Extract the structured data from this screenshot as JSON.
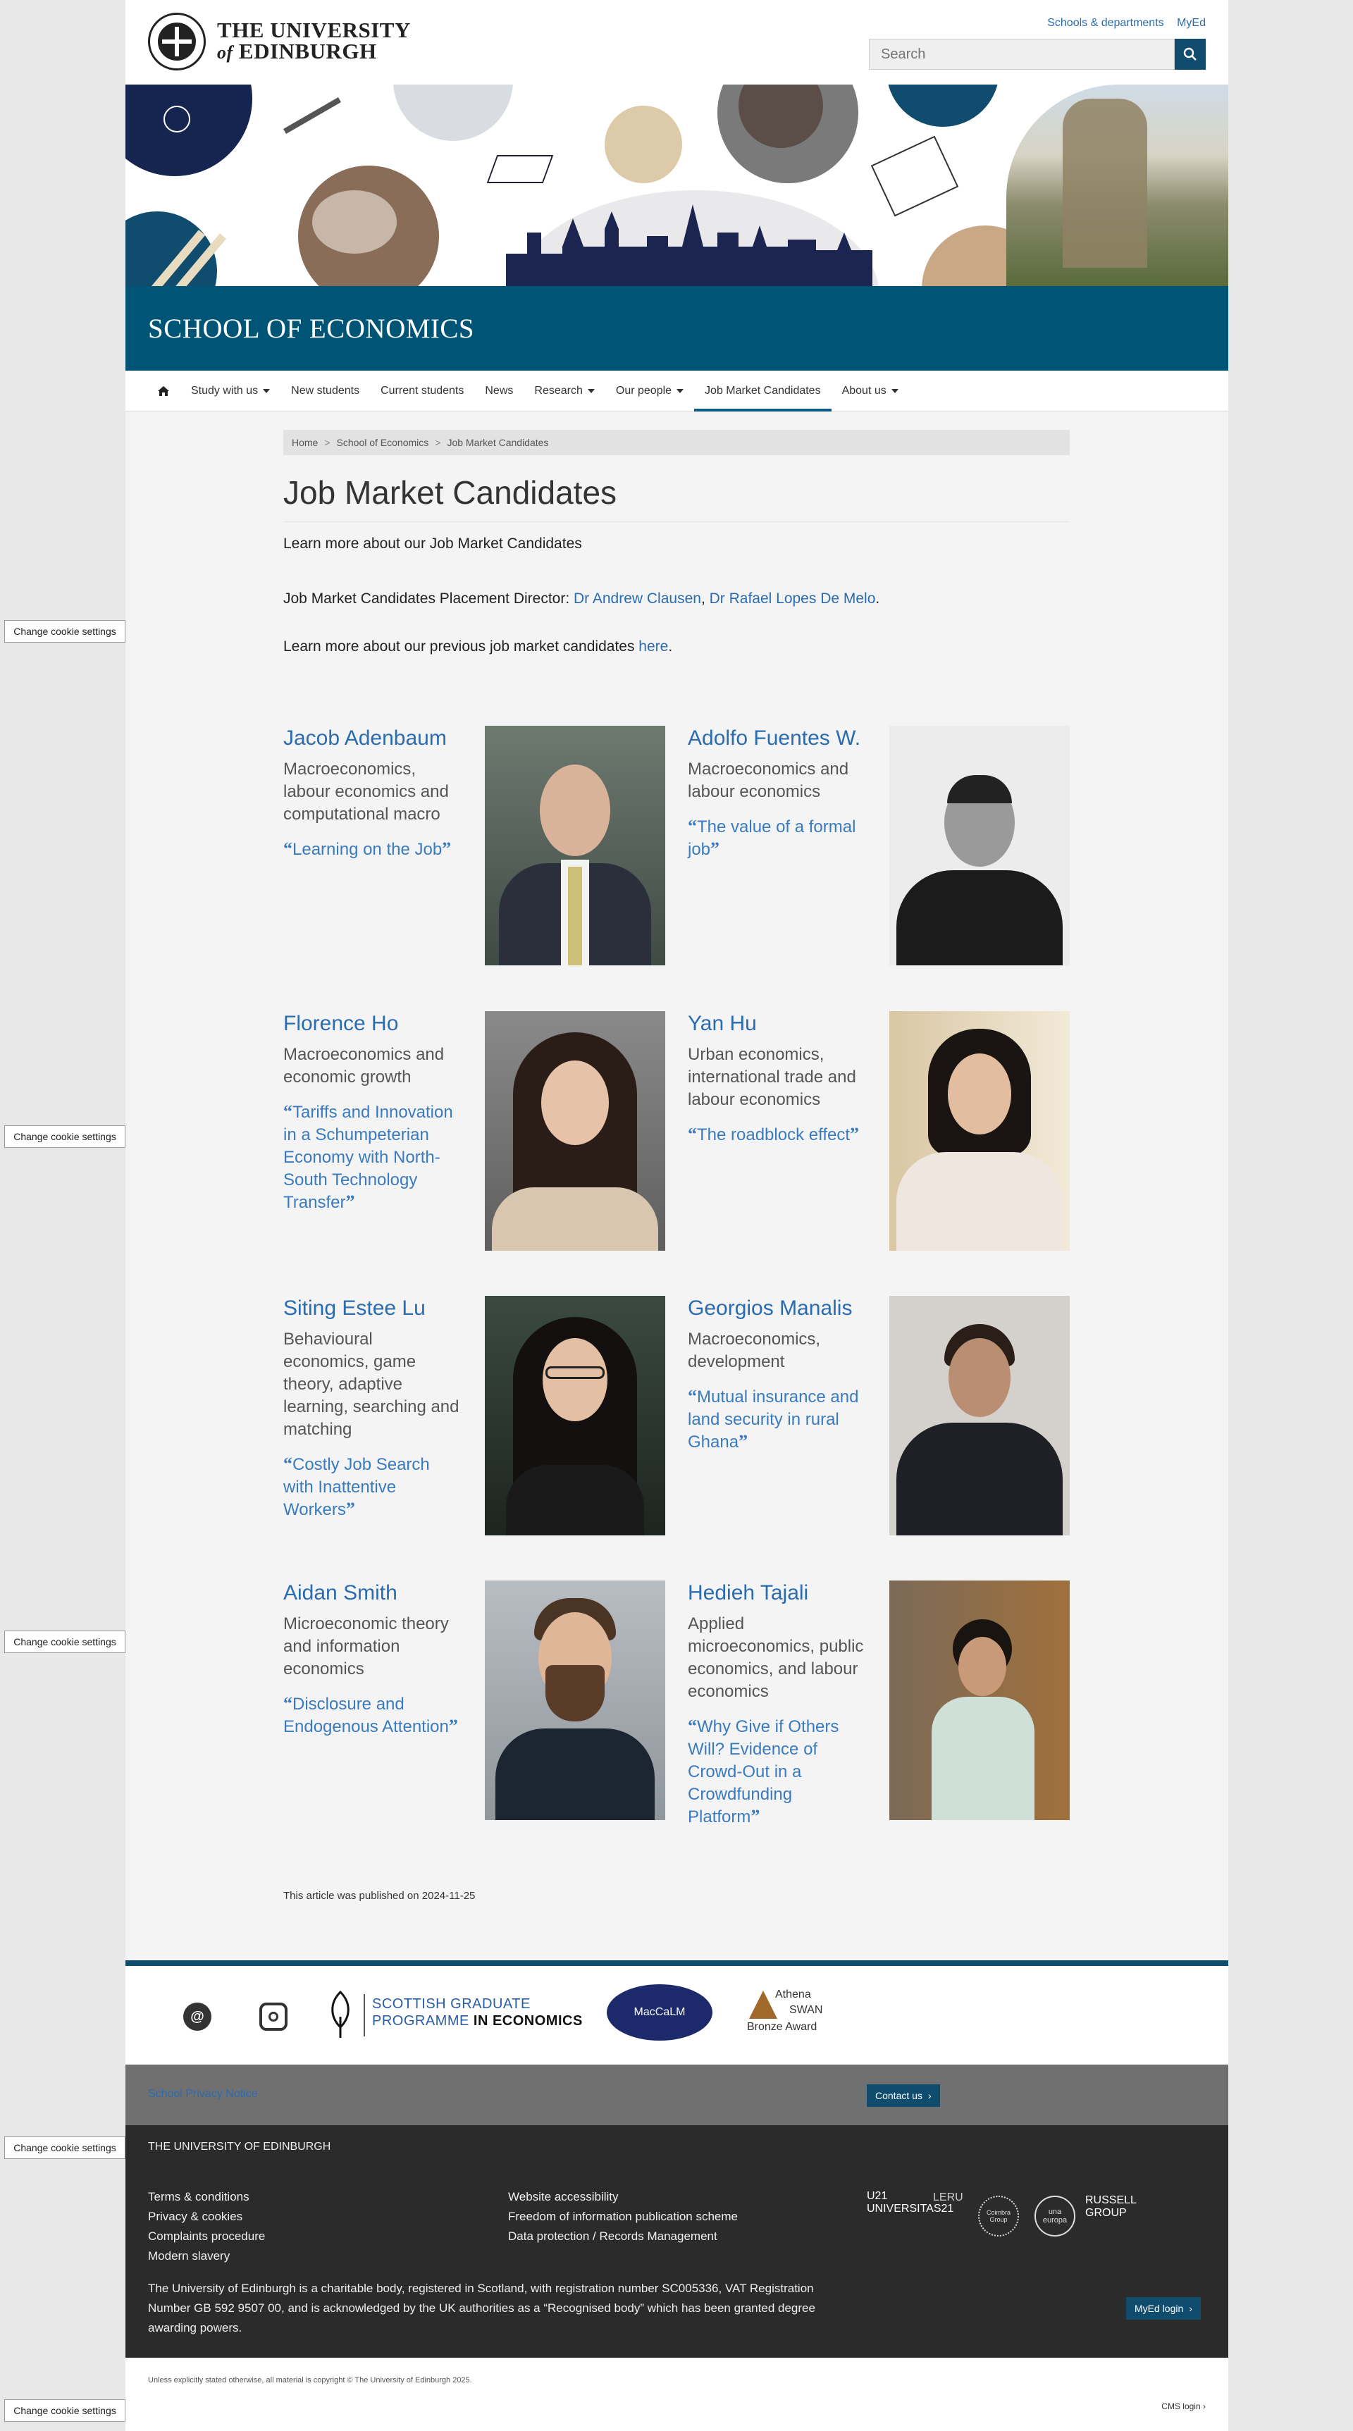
{
  "header": {
    "university_line1": "THE UNIVERSITY",
    "university_line2_of": "of",
    "university_line2": "EDINBURGH",
    "links": [
      "Schools & departments",
      "MyEd"
    ],
    "search_placeholder": "Search"
  },
  "banner": {
    "school_title": "SCHOOL OF ECONOMICS"
  },
  "nav": {
    "items": [
      {
        "label": "Study with us",
        "dropdown": true
      },
      {
        "label": "New students",
        "dropdown": false
      },
      {
        "label": "Current students",
        "dropdown": false
      },
      {
        "label": "News",
        "dropdown": false
      },
      {
        "label": "Research",
        "dropdown": true
      },
      {
        "label": "Our people",
        "dropdown": true
      },
      {
        "label": "Job Market Candidates",
        "dropdown": false
      },
      {
        "label": "About us",
        "dropdown": true
      }
    ],
    "active": "Job Market Candidates"
  },
  "breadcrumb": [
    "Home",
    "School of Economics",
    "Job Market Candidates"
  ],
  "page": {
    "title": "Job Market Candidates",
    "intro": "Learn more about our Job Market Candidates",
    "placement_prefix": "Job Market Candidates Placement Director: ",
    "director1": "Dr Andrew Clausen",
    "sep": ", ",
    "director2": "Dr Rafael Lopes De Melo",
    "dot": ".",
    "previous_prefix": "Learn more about our previous job market candidates ",
    "previous_link": "here",
    "published": "This article was published on 2024-11-25"
  },
  "candidates": [
    {
      "name": "Jacob Adenbaum",
      "field": "Macroeconomics, labour economics and computational macro",
      "title": "Learning on the Job"
    },
    {
      "name": "Adolfo Fuentes W.",
      "field": "Macroeconomics and labour economics",
      "title": "The value of a formal job"
    },
    {
      "name": "Florence Ho",
      "field": "Macroeconomics and economic growth",
      "title": "Tariffs and Innovation in a Schumpeterian Economy with North-South Technology Transfer"
    },
    {
      "name": "Yan Hu",
      "field": "Urban economics, international trade and labour economics",
      "title": "The roadblock effect"
    },
    {
      "name": "Siting Estee Lu",
      "field": "Behavioural economics, game theory, adaptive learning, searching and matching",
      "title": "Costly Job Search with Inattentive Workers"
    },
    {
      "name": "Georgios Manalis",
      "field": "Macroeconomics, development",
      "title": "Mutual insurance and land security in rural Ghana"
    },
    {
      "name": "Aidan Smith",
      "field": "Microeconomic theory and information economics",
      "title": "Disclosure and Endogenous Attention"
    },
    {
      "name": "Hedieh Tajali",
      "field": "Applied microeconomics, public economics, and labour economics",
      "title": "Why Give if Others Will? Evidence of Crowd-Out in a Crowdfunding Platform"
    }
  ],
  "logos": {
    "sgpe_line1": "SCOTTISH GRADUATE",
    "sgpe_line2a": "PROGRAMME ",
    "sgpe_line2b": "IN ECONOMICS",
    "maccalm": "MacCaLM",
    "athena1": "Athena",
    "athena2": "SWAN",
    "athena3": "Bronze Award"
  },
  "footer": {
    "privacy": "School Privacy Notice",
    "contact": "Contact us",
    "uni_name": "THE UNIVERSITY OF EDINBURGH",
    "col1": [
      "Terms & conditions",
      "Privacy & cookies",
      "Complaints procedure",
      "Modern slavery"
    ],
    "col2": [
      "Website accessibility",
      "Freedom of information publication scheme",
      "Data protection / Records Management"
    ],
    "charity": "The University of Edinburgh is a charitable body, registered in Scotland, with registration number SC005336, VAT Registration Number GB 592 9507 00, and is acknowledged by the UK authorities as a “Recognised body” which has been granted degree awarding powers.",
    "u21": "U21",
    "u21_sub": "UNIVERSITAS21",
    "leru": "LERU",
    "coimbra": "Coimbra Group",
    "una": "una europa",
    "russell1": "RUSSELL",
    "russell2": "GROUP",
    "myed_login": "MyEd login",
    "copyright": "Unless explicitly stated otherwise, all material is copyright © The University of Edinburgh 2025.",
    "cms_login": "CMS login"
  },
  "cookie_button": "Change cookie settings",
  "colors": {
    "brand_blue": "#005577",
    "link": "#2b6cb0",
    "footer_dark": "#2b2b2b"
  }
}
